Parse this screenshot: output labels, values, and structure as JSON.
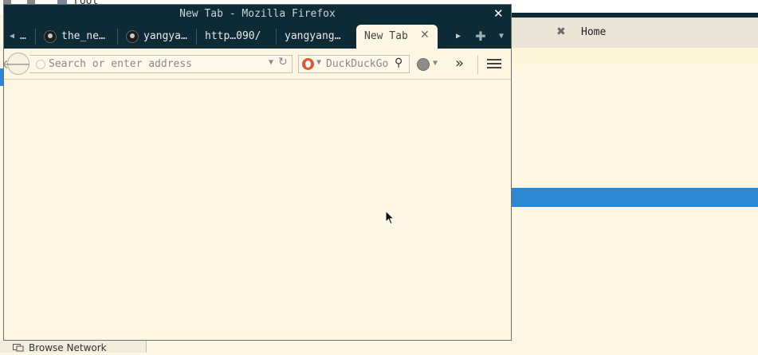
{
  "background_window": {
    "top_label": "root",
    "tab": {
      "label": "Home"
    },
    "sidebar": {
      "browse_network_label": "Browse Network"
    }
  },
  "browser": {
    "window_title": "New Tab - Mozilla Firefox",
    "tabs": [
      {
        "label": "…",
        "icon": "none"
      },
      {
        "label": "the_ne…",
        "icon": "github-icon"
      },
      {
        "label": "yangya…",
        "icon": "github-icon"
      },
      {
        "label": "http…090/",
        "icon": "none"
      },
      {
        "label": "yangyang…",
        "icon": "none"
      }
    ],
    "active_tab": {
      "label": "New Tab"
    },
    "urlbar": {
      "placeholder": "Search or enter address",
      "value": ""
    },
    "searchbar": {
      "engine": "DuckDuckGo",
      "placeholder": "DuckDuckGo"
    }
  },
  "colors": {
    "titlebar": "#0d2b36",
    "content_bg": "#fdf6e3",
    "selection": "#2b87d1"
  }
}
